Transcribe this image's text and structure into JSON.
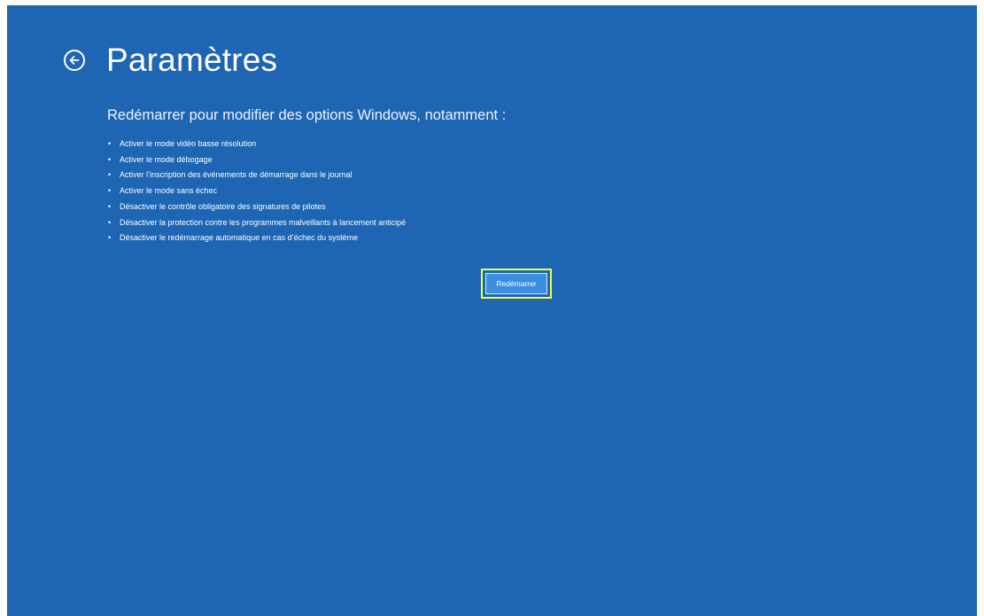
{
  "header": {
    "title": "Paramètres",
    "back_icon": "back-arrow-circle-icon"
  },
  "main": {
    "subtitle": "Redémarrer pour modifier des options Windows, notamment :",
    "options": [
      "Activer le mode vidéo basse résolution",
      "Activer le mode débogage",
      "Activer l’inscription des événements de démarrage dans le journal",
      "Activer le mode sans échec",
      "Désactiver le contrôle obligatoire des signatures de pilotes",
      "Désactiver la protection contre les programmes malveillants à lancement anticipé",
      "Désactiver le redémarrage automatique en cas d’échec du système"
    ],
    "restart_label": "Redémarrer"
  },
  "colors": {
    "background": "#1e65b4",
    "text": "#ffffff",
    "button": "#3b8de0",
    "highlight": "#f2ff33"
  }
}
